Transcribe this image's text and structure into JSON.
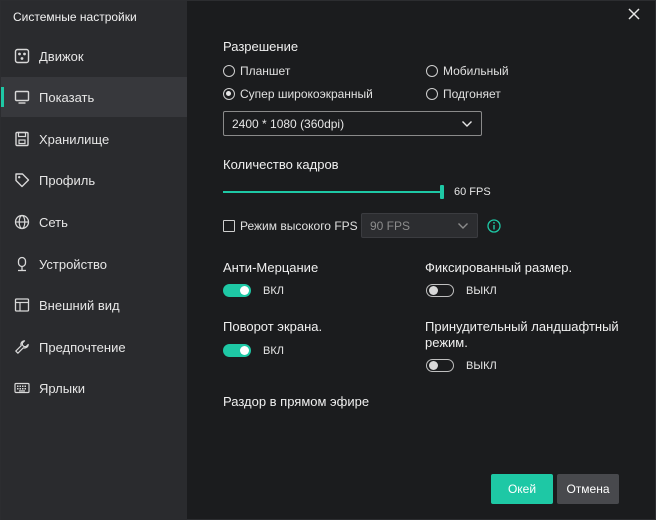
{
  "window": {
    "title": "Системные настройки"
  },
  "sidebar": {
    "items": [
      {
        "label": "Движок",
        "icon": "engine-icon"
      },
      {
        "label": "Показать",
        "icon": "monitor-icon",
        "active": true
      },
      {
        "label": "Хранилище",
        "icon": "storage-icon"
      },
      {
        "label": "Профиль",
        "icon": "tag-icon"
      },
      {
        "label": "Сеть",
        "icon": "globe-icon"
      },
      {
        "label": "Устройство",
        "icon": "device-icon"
      },
      {
        "label": "Внешний вид",
        "icon": "appearance-icon"
      },
      {
        "label": "Предпочтение",
        "icon": "wrench-icon"
      },
      {
        "label": "Ярлыки",
        "icon": "keyboard-icon"
      }
    ]
  },
  "resolution": {
    "title": "Разрешение",
    "options": [
      "Планшет",
      "Мобильный",
      "Супер широкоэкранный",
      "Подгоняет"
    ],
    "selected_option": "Супер широкоэкранный",
    "dropdown_value": "2400 * 1080 (360dpi)"
  },
  "framerate": {
    "title": "Количество кадров",
    "value_label": "60 FPS",
    "slider_fraction": 1.0,
    "high_fps_label": "Режим высокого FPS",
    "high_fps_checked": false,
    "high_fps_value": "90 FPS"
  },
  "toggles": {
    "anti_flicker": {
      "label": "Анти-Мерцание",
      "state": "ВКЛ",
      "on": true
    },
    "fixed_size": {
      "label": "Фиксированный размер.",
      "state": "ВЫКЛ",
      "on": false
    },
    "screen_rotation": {
      "label": "Поворот экрана.",
      "state": "ВКЛ",
      "on": true
    },
    "forced_landscape": {
      "label": "Принудительный ландшафтный режим.",
      "state": "ВЫКЛ",
      "on": false
    }
  },
  "discord": {
    "label": "Раздор в прямом эфире"
  },
  "buttons": {
    "ok": "Окей",
    "cancel": "Отмена"
  },
  "colors": {
    "accent": "#1ec8a5",
    "sidebar_bg": "#2a2b2e",
    "content_bg": "#1b1c1e"
  }
}
